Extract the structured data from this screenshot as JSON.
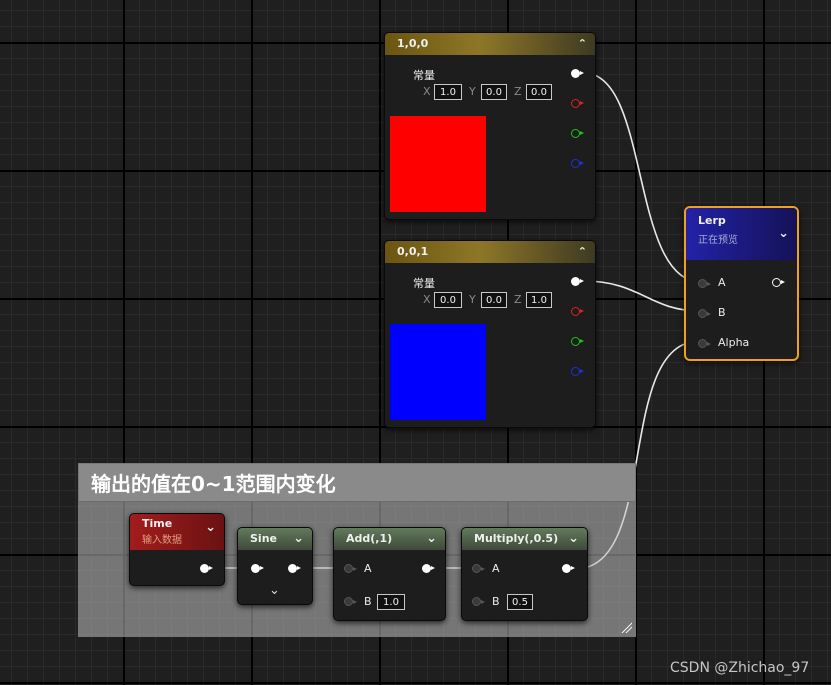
{
  "nodes": {
    "vector_red": {
      "title": "1,0,0",
      "label": "常量",
      "x_label": "X",
      "x_value": "1.0",
      "y_label": "Y",
      "y_value": "0.0",
      "z_label": "Z",
      "z_value": "0.0",
      "swatch_color": "#ff0000"
    },
    "vector_blue": {
      "title": "0,0,1",
      "label": "常量",
      "x_label": "X",
      "x_value": "0.0",
      "y_label": "Y",
      "y_value": "0.0",
      "z_label": "Z",
      "z_value": "1.0",
      "swatch_color": "#0000ff"
    },
    "lerp": {
      "title": "Lerp",
      "subtitle": "正在预览",
      "pin_a": "A",
      "pin_b": "B",
      "pin_alpha": "Alpha",
      "border_color": "#f0a020"
    },
    "time": {
      "title": "Time",
      "subtitle": "输入数据"
    },
    "sine": {
      "title": "Sine"
    },
    "add": {
      "title": "Add(,1)",
      "pin_a": "A",
      "pin_b": "B",
      "b_value": "1.0"
    },
    "multiply": {
      "title": "Multiply(,0.5)",
      "pin_a": "A",
      "pin_b": "B",
      "b_value": "0.5"
    }
  },
  "comment": {
    "title": "输出的值在0~1范围内变化"
  },
  "watermark": "CSDN @Zhichao_97",
  "colors": {
    "pin_red": "#e02020",
    "pin_green": "#20c020",
    "pin_blue": "#2030e0",
    "wire": "#e8e8e8"
  }
}
